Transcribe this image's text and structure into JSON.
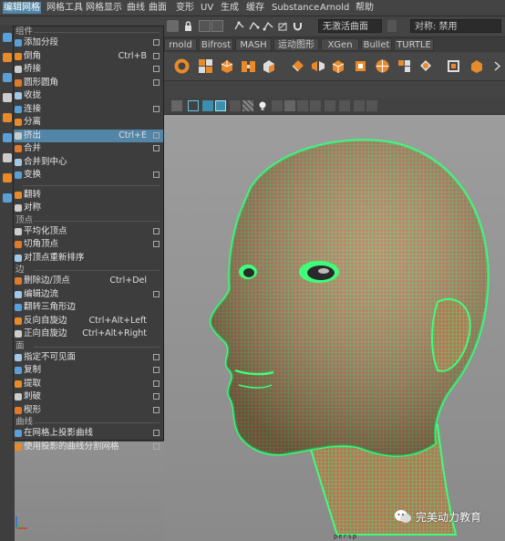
{
  "menubar": {
    "items": [
      "编辑网格",
      "网格工具",
      "网格显示",
      "曲线",
      "曲面",
      "变形",
      "UV",
      "生成",
      "缓存",
      "Substance",
      "Arnold",
      "帮助"
    ],
    "active_index": 0
  },
  "statusline": {
    "live_surface": "无激活曲面",
    "symmetry": "对称: 禁用"
  },
  "shelf": {
    "tabs": [
      "rnold",
      "Bifrost",
      "MASH",
      "运动图形",
      "XGen",
      "Bullet",
      "TURTLE"
    ]
  },
  "menu": {
    "sections": [
      {
        "header": "组件",
        "items": [
          {
            "label": "添加分段",
            "shortcut": "",
            "option": true,
            "icon": "add-divisions-icon"
          },
          {
            "label": "倒角",
            "shortcut": "Ctrl+B",
            "option": true,
            "icon": "bevel-icon"
          },
          {
            "label": "桥接",
            "shortcut": "",
            "option": true,
            "icon": "bridge-icon"
          },
          {
            "label": "圆形圆角",
            "shortcut": "",
            "option": true,
            "icon": "circularize-icon"
          },
          {
            "label": "收拢",
            "shortcut": "",
            "option": false,
            "icon": "collapse-icon"
          },
          {
            "label": "连接",
            "shortcut": "",
            "option": true,
            "icon": "connect-icon"
          },
          {
            "label": "分离",
            "shortcut": "",
            "option": false,
            "icon": "detach-icon"
          },
          {
            "label": "挤出",
            "shortcut": "Ctrl+E",
            "option": true,
            "icon": "extrude-icon",
            "highlighted": true
          },
          {
            "label": "合并",
            "shortcut": "",
            "option": true,
            "icon": "merge-icon"
          },
          {
            "label": "合并到中心",
            "shortcut": "",
            "option": false,
            "icon": "merge-center-icon"
          },
          {
            "label": "变换",
            "shortcut": "",
            "option": true,
            "icon": "transform-icon"
          }
        ]
      },
      {
        "header": "",
        "items": [
          {
            "label": "翻转",
            "shortcut": "",
            "option": false,
            "icon": "flip-icon"
          },
          {
            "label": "对称",
            "shortcut": "",
            "option": false,
            "icon": "symmetrize-icon"
          }
        ]
      },
      {
        "header": "顶点",
        "items": [
          {
            "label": "平均化顶点",
            "shortcut": "",
            "option": true,
            "icon": "average-vertices-icon"
          },
          {
            "label": "切角顶点",
            "shortcut": "",
            "option": true,
            "icon": "chamfer-vertices-icon"
          },
          {
            "label": "对顶点重新排序",
            "shortcut": "",
            "option": false,
            "icon": "reorder-vertices-icon"
          }
        ]
      },
      {
        "header": "边",
        "items": [
          {
            "label": "删除边/顶点",
            "shortcut": "Ctrl+Del",
            "option": false,
            "icon": "delete-edge-icon"
          },
          {
            "label": "编辑边流",
            "shortcut": "",
            "option": true,
            "icon": "edit-edge-flow-icon"
          },
          {
            "label": "翻转三角形边",
            "shortcut": "",
            "option": false,
            "icon": "flip-triangle-edge-icon"
          },
          {
            "label": "反向自旋边",
            "shortcut": "Ctrl+Alt+Left",
            "option": false,
            "icon": "spin-edge-backward-icon"
          },
          {
            "label": "正向自旋边",
            "shortcut": "Ctrl+Alt+Right",
            "option": false,
            "icon": "spin-edge-forward-icon"
          }
        ]
      },
      {
        "header": "面",
        "items": [
          {
            "label": "指定不可见面",
            "shortcut": "",
            "option": true,
            "icon": "assign-invisible-faces-icon"
          },
          {
            "label": "复制",
            "shortcut": "",
            "option": true,
            "icon": "duplicate-icon"
          },
          {
            "label": "提取",
            "shortcut": "",
            "option": true,
            "icon": "extract-icon"
          },
          {
            "label": "刺破",
            "shortcut": "",
            "option": true,
            "icon": "poke-icon"
          },
          {
            "label": "楔形",
            "shortcut": "",
            "option": true,
            "icon": "wedge-icon"
          }
        ]
      },
      {
        "header": "曲线",
        "items": [
          {
            "label": "在网格上投影曲线",
            "shortcut": "",
            "option": true,
            "icon": "project-curve-icon"
          },
          {
            "label": "使用投影的曲线分割网格",
            "shortcut": "",
            "option": true,
            "icon": "split-mesh-curve-icon"
          }
        ]
      }
    ]
  },
  "viewport": {
    "camera_label": "persp"
  },
  "watermark": {
    "text": "完美动力教育"
  },
  "colors": {
    "menu_highlight": "#5285a6",
    "wire": "#3dff7a",
    "skin": "#b07a57"
  }
}
